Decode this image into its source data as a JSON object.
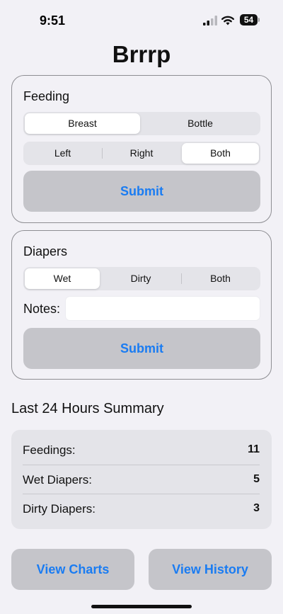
{
  "status_bar": {
    "time": "9:51",
    "battery": "54"
  },
  "app": {
    "title": "Brrrp"
  },
  "feeding": {
    "title": "Feeding",
    "type_options": [
      "Breast",
      "Bottle"
    ],
    "type_selected": "Breast",
    "side_options": [
      "Left",
      "Right",
      "Both"
    ],
    "side_selected": "Both",
    "submit_label": "Submit"
  },
  "diapers": {
    "title": "Diapers",
    "type_options": [
      "Wet",
      "Dirty",
      "Both"
    ],
    "type_selected": "Wet",
    "notes_label": "Notes:",
    "notes_value": "",
    "submit_label": "Submit"
  },
  "summary": {
    "heading": "Last 24 Hours Summary",
    "rows": [
      {
        "label": "Feedings:",
        "value": "11"
      },
      {
        "label": "Wet Diapers:",
        "value": "5"
      },
      {
        "label": "Dirty Diapers:",
        "value": "3"
      }
    ]
  },
  "actions": {
    "charts_label": "View Charts",
    "history_label": "View History"
  },
  "colors": {
    "accent": "#1a7cf2",
    "background": "#f2f1f6",
    "button_fill": "#c5c5ca",
    "segment_track": "#e4e4e9"
  }
}
